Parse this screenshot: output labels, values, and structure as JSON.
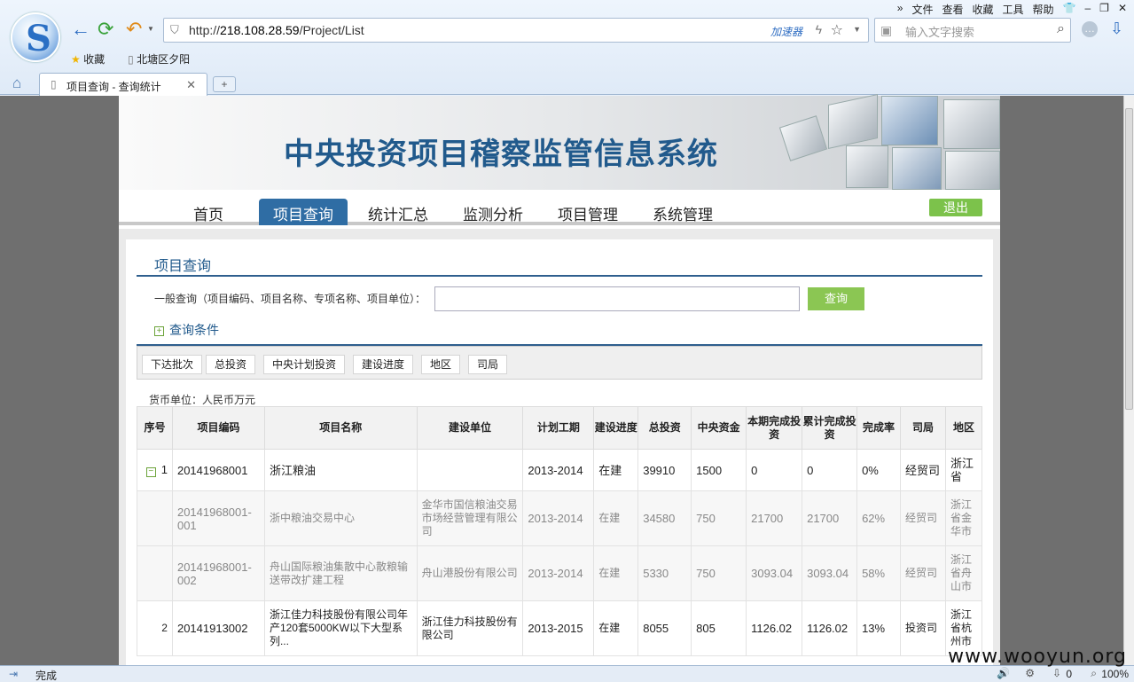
{
  "browser": {
    "menus": [
      "文件",
      "查看",
      "收藏",
      "工具",
      "帮助"
    ],
    "url_prefix": "http://",
    "url_host": "218.108.28.59",
    "url_path": "/Project/List",
    "accelerator": "加速器",
    "search_placeholder": "输入文字搜索",
    "favorites": [
      "收藏",
      "北塘区夕阳"
    ],
    "tab_title": "项目查询 - 查询统计",
    "status": "完成",
    "zoom": "100%",
    "download_count": "0"
  },
  "site": {
    "title": "中央投资项目稽察监管信息系统",
    "nav": [
      "首页",
      "项目查询",
      "统计汇总",
      "监测分析",
      "项目管理",
      "系统管理"
    ],
    "active_nav": "项目查询",
    "logout": "退出"
  },
  "query": {
    "panel_title": "项目查询",
    "general_label": "一般查询（项目编码、项目名称、专项名称、项目单位）：",
    "input_value": "",
    "search_button": "查询",
    "conditions_label": "查询条件",
    "sort_buttons": [
      "下达批次",
      "总投资",
      "中央计划投资",
      "建设进度",
      "地区",
      "司局"
    ],
    "currency_unit": "货币单位：人民币万元"
  },
  "table": {
    "headers": [
      "序号",
      "项目编码",
      "项目名称",
      "建设单位",
      "计划工期",
      "建设进度",
      "总投资",
      "中央资金",
      "本期完成投资",
      "累计完成投资",
      "完成率",
      "司局",
      "地区"
    ],
    "rows": [
      {
        "seq": "1",
        "code": "20141968001",
        "name": "浙江粮油",
        "unit": "",
        "period": "2013-2014",
        "progress": "在建",
        "total": "39910",
        "central": "1500",
        "current": "0",
        "cumulative": "0",
        "rate": "0%",
        "dept": "经贸司",
        "region": "浙江省"
      },
      {
        "seq": "",
        "code": "20141968001-001",
        "name": "浙中粮油交易中心",
        "unit": "金华市国信粮油交易市场经营管理有限公司",
        "period": "2013-2014",
        "progress": "在建",
        "total": "34580",
        "central": "750",
        "current": "21700",
        "cumulative": "21700",
        "rate": "62%",
        "dept": "经贸司",
        "region": "浙江省金华市"
      },
      {
        "seq": "",
        "code": "20141968001-002",
        "name": "舟山国际粮油集散中心散粮输送带改扩建工程",
        "unit": "舟山港股份有限公司",
        "period": "2013-2014",
        "progress": "在建",
        "total": "5330",
        "central": "750",
        "current": "3093.04",
        "cumulative": "3093.04",
        "rate": "58%",
        "dept": "经贸司",
        "region": "浙江省舟山市"
      },
      {
        "seq": "2",
        "code": "20141913002",
        "name": "浙江佳力科技股份有限公司年产120套5000KW以下大型系列...",
        "unit": "浙江佳力科技股份有限公司",
        "period": "2013-2015",
        "progress": "在建",
        "total": "8055",
        "central": "805",
        "current": "1126.02",
        "cumulative": "1126.02",
        "rate": "13%",
        "dept": "投资司",
        "region": "浙江省杭州市"
      }
    ]
  },
  "watermark": "www.wooyun.org"
}
